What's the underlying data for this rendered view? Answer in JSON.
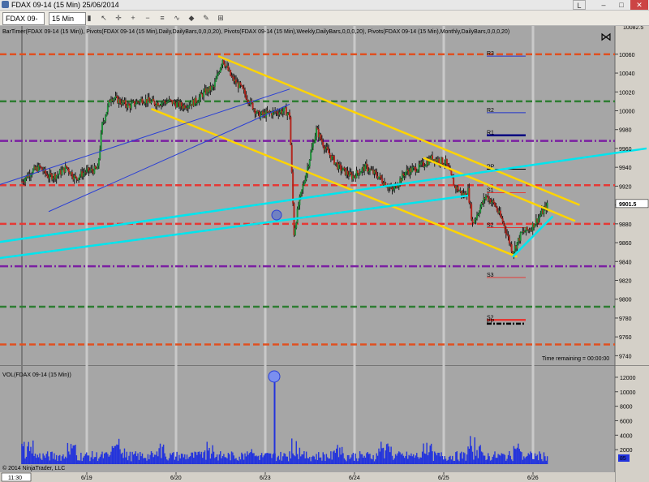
{
  "window": {
    "title": "FDAX 09-14 (15 Min)  25/06/2014",
    "l_button": "L",
    "min": "–",
    "max": "□",
    "close": "✕"
  },
  "toolbar": {
    "instrument": "FDAX 09-14",
    "interval": "15 Min",
    "instrument_icon": "chevron-down-icon",
    "interval_icon": "chevron-down-icon"
  },
  "chart_data": {
    "type": "candlestick",
    "header_text": "BarTimer(FDAX 09-14 (15 Min)), Pivots(FDAX 09-14 (15 Min),Daily,DailyBars,0,0,0,20), Pivots(FDAX 09-14 (15 Min),Weekly,DailyBars,0,0,0,20), Pivots(FDAX 09-14 (15 Min),Monthly,DailyBars,0,0,0,20)",
    "ylim": [
      9730,
      10090
    ],
    "y_ticks": [
      9740,
      9760,
      9780,
      9800,
      9820,
      9840,
      9860,
      9880,
      9900,
      9920,
      9940,
      9960,
      9980,
      10000,
      10020,
      10040,
      10060
    ],
    "top_label": "10082.5",
    "last_price": "9901.5",
    "x_ticks": [
      "11:30",
      "6/19",
      "6/20",
      "6/23",
      "6/24",
      "6/25",
      "6/26"
    ],
    "session_lines": [
      0.0,
      1.0,
      2.0,
      3.0,
      4.0,
      5.0
    ],
    "time_remaining": "Time remaining = 00:00:00",
    "copyright": "© 2014 NinjaTrader, LLC",
    "pivot_levels": [
      {
        "value": 10060,
        "color": "#e05020",
        "style": "dash"
      },
      {
        "value": 10010,
        "color": "#2e7d32",
        "style": "dash"
      },
      {
        "value": 9968,
        "color": "#7b1fa2",
        "style": "dash"
      },
      {
        "value": 9921,
        "color": "#e53935",
        "style": "dash"
      },
      {
        "value": 9880,
        "color": "#e53935",
        "style": "dash"
      },
      {
        "value": 9835,
        "color": "#7b1fa2",
        "style": "dash"
      },
      {
        "value": 9792,
        "color": "#2e7d32",
        "style": "dash"
      },
      {
        "value": 9752,
        "color": "#e05020",
        "style": "dash"
      }
    ],
    "daily_pivots": [
      {
        "name": "R3",
        "value": 10058,
        "color": "#2233cc"
      },
      {
        "name": "R2",
        "value": 9998,
        "color": "#2233cc"
      },
      {
        "name": "R1",
        "value": 9974,
        "color": "#000080"
      },
      {
        "name": "PP",
        "value": 9938,
        "color": "#000000"
      },
      {
        "name": "S1",
        "value": 9913,
        "color": "#e53935"
      },
      {
        "name": "S2",
        "value": 9876,
        "color": "#e53935"
      },
      {
        "name": "S3",
        "value": 9823,
        "color": "#e53935"
      },
      {
        "name": "S2",
        "value": 9778,
        "color": "#e53935"
      },
      {
        "name": "PP",
        "value": 9774,
        "color": "#000000"
      }
    ],
    "price_path": [
      [
        0.0,
        9925
      ],
      [
        0.1,
        9935
      ],
      [
        0.2,
        9940
      ],
      [
        0.3,
        9930
      ],
      [
        0.4,
        9932
      ],
      [
        0.5,
        9940
      ],
      [
        0.6,
        9928
      ],
      [
        0.7,
        9935
      ],
      [
        0.85,
        9938
      ],
      [
        0.9,
        9985
      ],
      [
        1.0,
        10015
      ],
      [
        1.1,
        10010
      ],
      [
        1.2,
        10005
      ],
      [
        1.35,
        10012
      ],
      [
        1.5,
        10008
      ],
      [
        1.65,
        10010
      ],
      [
        1.8,
        10005
      ],
      [
        1.95,
        10010
      ],
      [
        2.05,
        10020
      ],
      [
        2.15,
        10025
      ],
      [
        2.25,
        10055
      ],
      [
        2.35,
        10035
      ],
      [
        2.45,
        10025
      ],
      [
        2.55,
        10010
      ],
      [
        2.65,
        9995
      ],
      [
        2.8,
        9998
      ],
      [
        2.95,
        10000
      ],
      [
        3.0,
        9995
      ],
      [
        3.05,
        9870
      ],
      [
        3.1,
        9900
      ],
      [
        3.2,
        9940
      ],
      [
        3.3,
        9980
      ],
      [
        3.4,
        9960
      ],
      [
        3.55,
        9940
      ],
      [
        3.7,
        9930
      ],
      [
        3.85,
        9940
      ],
      [
        4.0,
        9930
      ],
      [
        4.15,
        9915
      ],
      [
        4.3,
        9935
      ],
      [
        4.45,
        9940
      ],
      [
        4.6,
        9950
      ],
      [
        4.75,
        9945
      ],
      [
        4.85,
        9920
      ],
      [
        4.95,
        9910
      ],
      [
        5.0,
        9915
      ],
      [
        5.05,
        9880
      ],
      [
        5.2,
        9910
      ],
      [
        5.3,
        9900
      ],
      [
        5.4,
        9880
      ],
      [
        5.5,
        9850
      ],
      [
        5.6,
        9870
      ],
      [
        5.7,
        9875
      ],
      [
        5.8,
        9888
      ],
      [
        5.9,
        9901
      ]
    ],
    "trendlines": [
      {
        "color": "#ffd400",
        "from": [
          2.2,
          10058
        ],
        "to": [
          6.25,
          9900
        ]
      },
      {
        "color": "#ffd400",
        "from": [
          1.45,
          10002
        ],
        "to": [
          5.55,
          9845
        ]
      },
      {
        "color": "#ffd400",
        "from": [
          4.5,
          9950
        ],
        "to": [
          6.2,
          9883
        ]
      },
      {
        "color": "#00e5ee",
        "from": [
          -0.3,
          9860
        ],
        "to": [
          7.0,
          9960
        ]
      },
      {
        "color": "#00e5ee",
        "from": [
          -0.3,
          9843
        ],
        "to": [
          5.0,
          9910
        ]
      },
      {
        "color": "#00e5ee",
        "from": [
          5.5,
          9845
        ],
        "to": [
          5.95,
          9888
        ]
      },
      {
        "color": "#2a3fd6",
        "from": [
          -0.3,
          9920
        ],
        "to": [
          3.0,
          10023
        ]
      },
      {
        "color": "#2a3fd6",
        "from": [
          0.3,
          9893
        ],
        "to": [
          3.0,
          10007
        ]
      }
    ],
    "volume": {
      "label": "VOL(FDAX 09-14 (15 Min))",
      "ylim": [
        0,
        13000
      ],
      "y_ticks": [
        2000,
        4000,
        6000,
        8000,
        10000,
        12000
      ],
      "last": "85",
      "spike": {
        "x": 3.02,
        "value": 11500
      }
    }
  }
}
